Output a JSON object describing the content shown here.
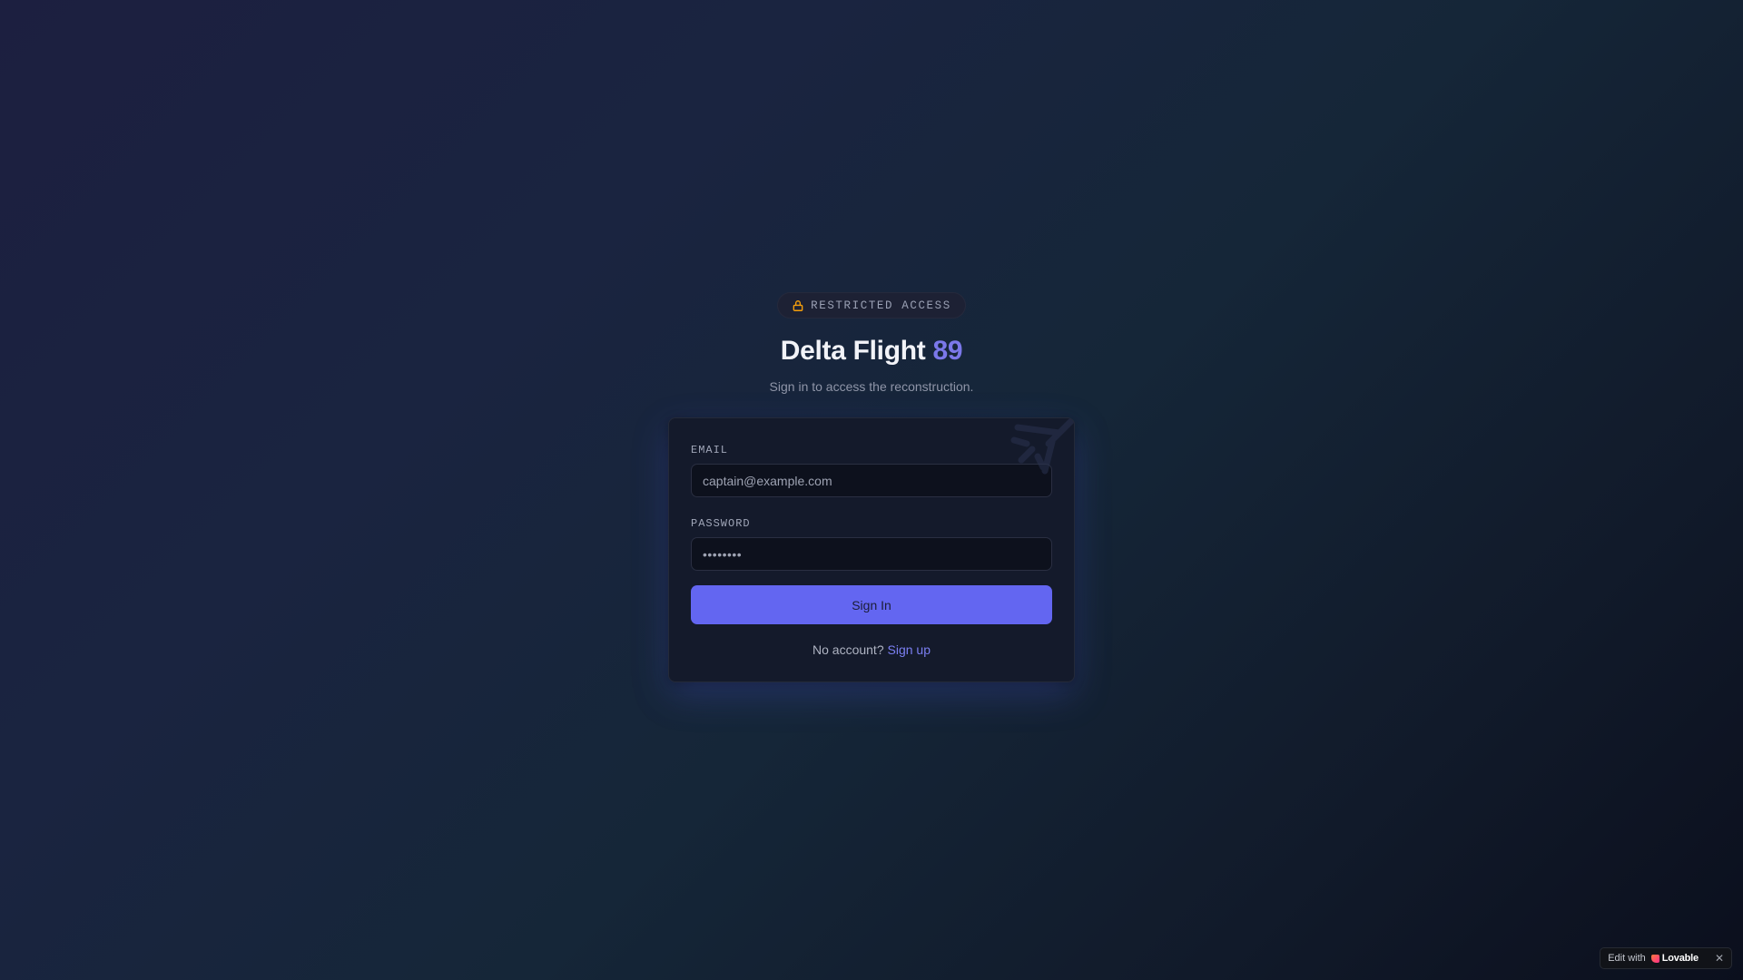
{
  "badge": {
    "icon": "lock-icon",
    "icon_color": "#f59e0b",
    "text": "RESTRICTED ACCESS"
  },
  "header": {
    "title_main": "Delta Flight ",
    "title_accent": "89",
    "accent_color": "#7b78ea",
    "subtitle": "Sign in to access the reconstruction."
  },
  "form": {
    "email_label": "EMAIL",
    "email_placeholder": "captain@example.com",
    "password_label": "PASSWORD",
    "password_placeholder": "••••••••",
    "submit_label": "Sign In",
    "submit_color": "#6366f1",
    "footer_text": "No account? ",
    "signup_link": "Sign up",
    "decoration_icon": "plane-icon"
  },
  "lovable": {
    "edit_text": "Edit with",
    "brand": "Lovable",
    "close_icon": "close-icon",
    "close_glyph": "✕"
  }
}
